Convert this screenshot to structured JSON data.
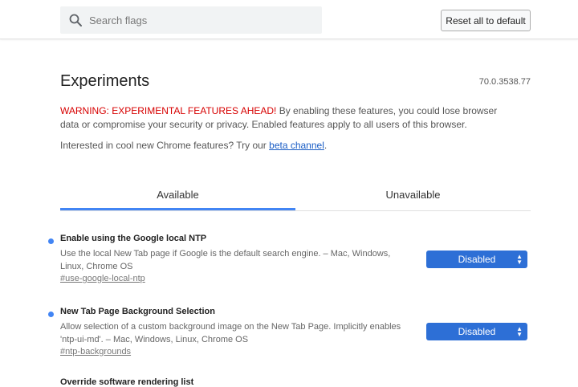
{
  "header": {
    "search_placeholder": "Search flags",
    "reset_label": "Reset all to default"
  },
  "main": {
    "title": "Experiments",
    "version": "70.0.3538.77",
    "warning_red": "WARNING: EXPERIMENTAL FEATURES AHEAD!",
    "warning_rest": " By enabling these features, you could lose browser data or compromise your security or privacy. Enabled features apply to all users of this browser.",
    "interest_text": "Interested in cool new Chrome features? Try our ",
    "interest_link": "beta channel",
    "interest_end": "."
  },
  "tabs": [
    {
      "label": "Available",
      "active": true
    },
    {
      "label": "Unavailable",
      "active": false
    }
  ],
  "experiments": [
    {
      "name": "Enable using the Google local NTP",
      "description": "Use the local New Tab page if Google is the default search engine. – Mac, Windows, Linux, Chrome OS",
      "hash": "#use-google-local-ntp",
      "value": "Disabled"
    },
    {
      "name": "New Tab Page Background Selection",
      "description": "Allow selection of a custom background image on the New Tab Page. Implicitly enables 'ntp-ui-md'. – Mac, Windows, Linux, Chrome OS",
      "hash": "#ntp-backgrounds",
      "value": "Disabled"
    },
    {
      "name": "Override software rendering list"
    }
  ],
  "colors": {
    "accent": "#4285f4",
    "select_bg": "#2d6fd6",
    "warning": "#d70000",
    "link": "#1a5dc5"
  },
  "icons": {
    "search": "search-icon",
    "dot": "bullet-dot-icon",
    "select_arrows": "updown-arrows-icon"
  }
}
